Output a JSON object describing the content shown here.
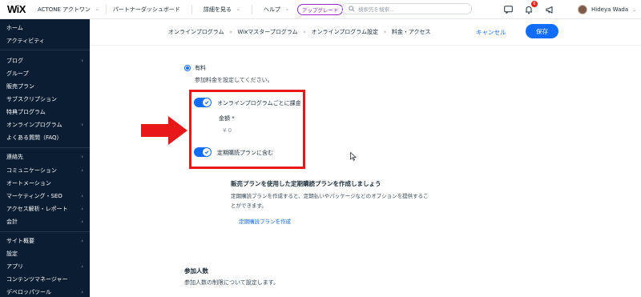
{
  "topbar": {
    "logo": "WiX",
    "site_name": "ACTONE アクトワン",
    "nav": [
      "パートナーダッシュボード",
      "詳細を見る",
      "ヘルプ"
    ],
    "upgrade": "アップグレード",
    "search_placeholder": "検索先を検索...",
    "notification_count": "6",
    "user_name": "Hideya Wada"
  },
  "sidebar": {
    "items": [
      {
        "label": "ホーム",
        "arrow": ""
      },
      {
        "label": "アクティビティ",
        "arrow": ""
      },
      {
        "label": "ブログ",
        "arrow": "›"
      },
      {
        "label": "グループ",
        "arrow": ""
      },
      {
        "label": "販売プラン",
        "arrow": ""
      },
      {
        "label": "サブスクリプション",
        "arrow": ""
      },
      {
        "label": "特典プログラム",
        "arrow": ""
      },
      {
        "label": "オンラインプログラム",
        "arrow": "›"
      },
      {
        "label": "よくある質問（FAQ）",
        "arrow": ""
      },
      {
        "label": "連絡先",
        "arrow": "›"
      },
      {
        "label": "コミュニケーション",
        "arrow": "›"
      },
      {
        "label": "オートメーション",
        "arrow": ""
      },
      {
        "label": "マーケティング・SEO",
        "arrow": "›"
      },
      {
        "label": "アクセス解析・レポート",
        "arrow": "›"
      },
      {
        "label": "会計",
        "arrow": "›"
      },
      {
        "label": "サイト概要",
        "arrow": "›"
      },
      {
        "label": "設定",
        "arrow": ""
      },
      {
        "label": "アプリ",
        "arrow": "›"
      },
      {
        "label": "コンテンツマネージャー",
        "arrow": ""
      },
      {
        "label": "デベロッパツール",
        "arrow": "›"
      }
    ]
  },
  "breadcrumb": {
    "items": [
      "オンラインプログラム",
      "Wixマスタープログラム",
      "オンラインプログラム設定",
      "料金・アクセス"
    ],
    "separator": "›"
  },
  "actions": {
    "cancel": "キャンセル",
    "save": "保存"
  },
  "pricing": {
    "paid_label": "有料",
    "paid_desc": "参加料金を設定してください。",
    "per_program_toggle": "オンラインプログラムごとに課金",
    "amount_label": "金額 *",
    "amount_value": "¥ 0",
    "subscription_toggle": "定期購読プランに含む"
  },
  "plan_section": {
    "title": "販売プランを使用した定期購読プランを作成しましょう",
    "desc_line1": "定期購読プランを作成すると、定期払いやパッケージなどのオプションを提供するこ",
    "desc_line2": "とができます。",
    "link": "定期購読プランを作成"
  },
  "participants": {
    "title": "参加人数",
    "desc": "参加人数の制限について設定します。"
  },
  "colors": {
    "accent": "#116dff",
    "highlight": "#e81818",
    "sidebar": "#0a1d33"
  }
}
